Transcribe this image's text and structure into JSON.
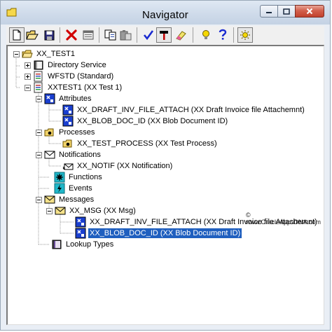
{
  "window": {
    "title": "Navigator"
  },
  "toolbar": {
    "buttons": [
      {
        "name": "new-icon"
      },
      {
        "name": "open-icon"
      },
      {
        "name": "save-icon"
      },
      {
        "name": "delete-icon"
      },
      {
        "name": "properties-icon"
      },
      {
        "name": "copy-icon"
      },
      {
        "name": "paste-icon"
      },
      {
        "name": "verify-icon"
      },
      {
        "name": "hammer-icon"
      },
      {
        "name": "eraser-icon"
      },
      {
        "name": "lightbulb-icon"
      },
      {
        "name": "help-icon"
      },
      {
        "name": "sun-icon"
      }
    ]
  },
  "tree": [
    {
      "label": "XX_TEST1",
      "icon": "folder-icon",
      "expander": "minus"
    },
    {
      "label": "Directory Service",
      "icon": "directory-book-icon",
      "expander": "plus"
    },
    {
      "label": "WFSTD (Standard)",
      "icon": "item-type-icon",
      "expander": "plus"
    },
    {
      "label": "XXTEST1 (XX Test 1)",
      "icon": "item-type-icon",
      "expander": "minus"
    },
    {
      "label": "Attributes",
      "icon": "attribute-icon",
      "expander": "minus"
    },
    {
      "label": "XX_DRAFT_INV_FILE_ATTACH (XX Draft Invoice file Attachemnt)",
      "icon": "attribute-icon"
    },
    {
      "label": "XX_BLOB_DOC_ID (XX Blob Document ID)",
      "icon": "attribute-icon"
    },
    {
      "label": "Processes",
      "icon": "process-icon",
      "expander": "minus"
    },
    {
      "label": "XX_TEST_PROCESS (XX Test Process)",
      "icon": "process-icon"
    },
    {
      "label": "Notifications",
      "icon": "notification-icon",
      "expander": "minus"
    },
    {
      "label": "XX_NOTIF (XX Notification)",
      "icon": "notification-icon"
    },
    {
      "label": "Functions",
      "icon": "function-icon"
    },
    {
      "label": "Events",
      "icon": "event-icon"
    },
    {
      "label": "Messages",
      "icon": "message-icon",
      "expander": "minus"
    },
    {
      "label": "XX_MSG (XX Msg)",
      "icon": "message-icon",
      "expander": "minus"
    },
    {
      "label": "XX_DRAFT_INV_FILE_ATTACH (XX Draft Invoice file Attachemnt)",
      "icon": "attribute-icon"
    },
    {
      "label": "XX_BLOB_DOC_ID (XX Blob Document ID)",
      "icon": "attribute-icon",
      "selected": true
    },
    {
      "label": "Lookup Types",
      "icon": "lookup-book-icon"
    }
  ],
  "watermark": "© www.OracleAppsDNA.com",
  "colors": {
    "selection": "#1f5fbf",
    "close_button": "#c2412d",
    "titlebar": "#cfdbea"
  }
}
